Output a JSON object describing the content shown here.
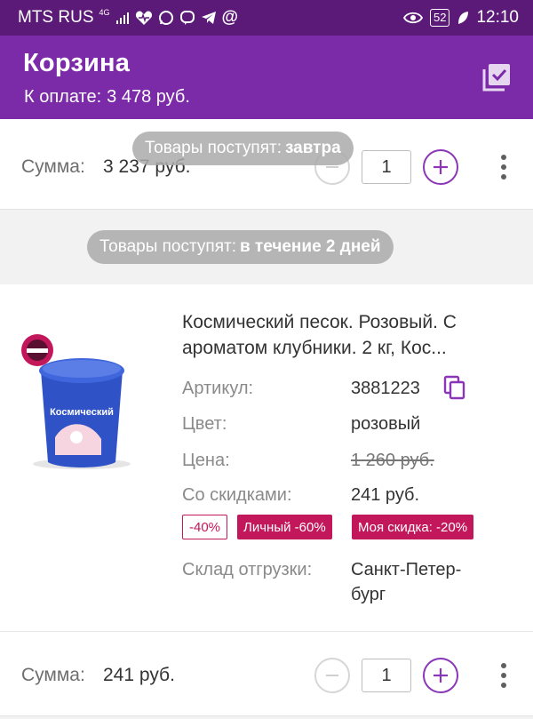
{
  "status_bar": {
    "carrier": "MTS RUS",
    "network": "4G",
    "battery": "52",
    "time": "12:10",
    "icons": [
      "signal-icon",
      "heart-icon",
      "whatsapp-icon",
      "viber-icon",
      "telegram-icon",
      "at-icon",
      "eye-icon",
      "battery-icon",
      "leaf-icon"
    ]
  },
  "app_bar": {
    "title": "Корзина",
    "payment_label": "К оплате:",
    "payment_value": "3 478 руб.",
    "select_all_icon": "checklist-icon"
  },
  "top_item": {
    "sum_label": "Сумма:",
    "sum_value": "3 237 руб.",
    "quantity": "1"
  },
  "delivery_tomorrow": {
    "prefix": "Товары поступят:",
    "value": "завтра"
  },
  "delivery_two_days": {
    "prefix": "Товары поступят:",
    "value": "в течение 2 дней"
  },
  "product": {
    "title": "Космический песок. Розовый. С ароматом клубники. 2 кг, Кос...",
    "article_label": "Артикул:",
    "article_value": "3881223",
    "color_label": "Цвет:",
    "color_value": "розовый",
    "price_label": "Цена:",
    "price_value": "1 260 руб.",
    "discount_price_label": "Со скидками:",
    "discount_price_value": "241 руб.",
    "badges": [
      "-40%",
      "Личный -60%",
      "Моя скидка: -20%"
    ],
    "warehouse_label": "Склад отгрузки:",
    "warehouse_value_line1": "Санкт-Петер-",
    "warehouse_value_line2": "бург",
    "image_text": "Космический"
  },
  "bottom_item": {
    "sum_label": "Сумма:",
    "sum_value": "241 руб.",
    "quantity": "1"
  },
  "colors": {
    "status_bar": "#5c1a78",
    "app_bar": "#7b2aa8",
    "accent": "#8a36b6",
    "badge": "#c2185b",
    "pill": "#aaaaaa"
  }
}
